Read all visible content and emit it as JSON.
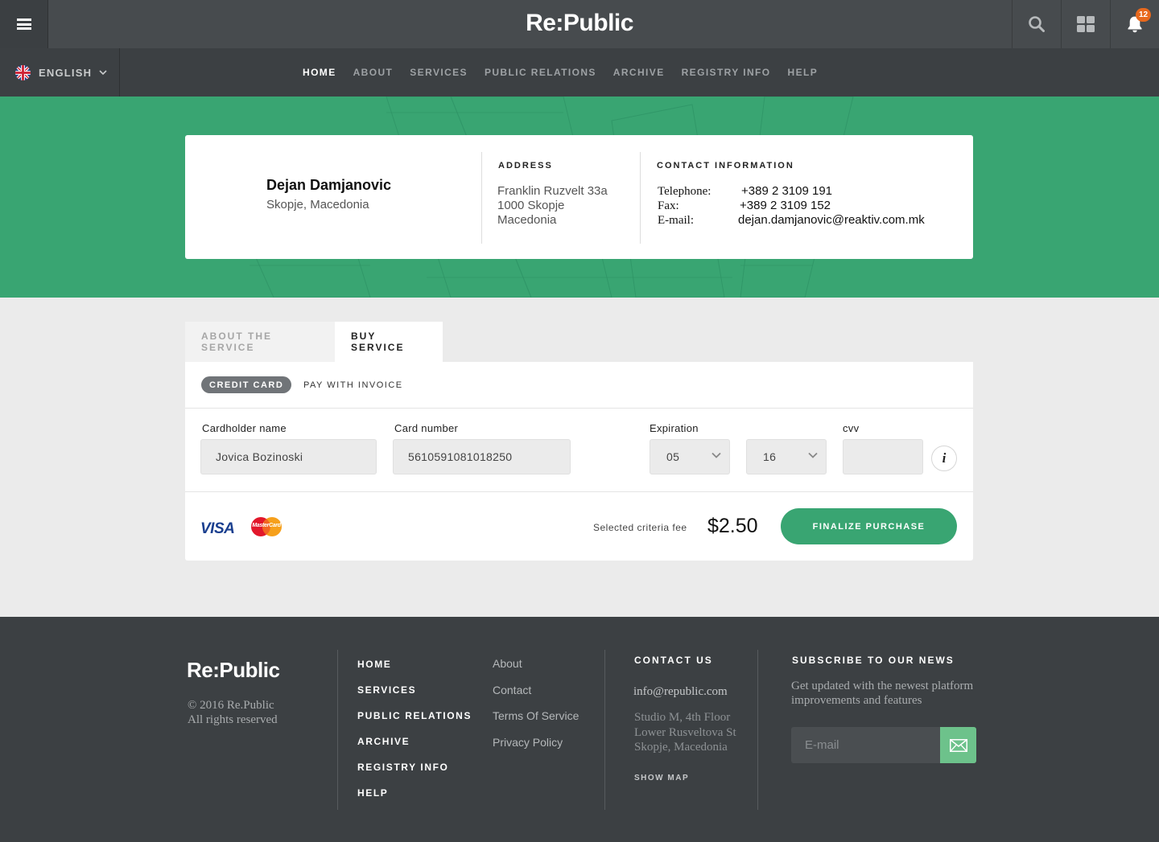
{
  "header": {
    "logo": "Re:Public",
    "notification_count": "12"
  },
  "language": {
    "selected": "ENGLISH"
  },
  "nav": {
    "items": [
      "HOME",
      "ABOUT",
      "SERVICES",
      "PUBLIC RELATIONS",
      "ARCHIVE",
      "REGISTRY INFO",
      "HELP"
    ],
    "active": "HOME"
  },
  "profile": {
    "name": "Dejan Damjanovic",
    "location": "Skopje, Macedonia",
    "address_heading": "ADDRESS",
    "address_lines": [
      "Franklin Ruzvelt 33a",
      "1000 Skopje",
      "Macedonia"
    ],
    "contact_heading": "CONTACT INFORMATION",
    "contact": [
      {
        "label": "Telephone:",
        "value": "+389 2 3109 191"
      },
      {
        "label": "Fax:",
        "value": "+389 2 3109 152"
      },
      {
        "label": "E-mail:",
        "value": "dejan.damjanovic@reaktiv.com.mk"
      }
    ]
  },
  "tabs": [
    {
      "label": "ABOUT THE SERVICE",
      "active": false
    },
    {
      "label": "BUY SERVICE",
      "active": true
    }
  ],
  "payment": {
    "methods": {
      "credit_card": "CREDIT CARD",
      "invoice": "PAY WITH INVOICE"
    },
    "fields": {
      "cardholder_label": "Cardholder name",
      "cardholder_value": "Jovica Bozinoski",
      "card_number_label": "Card number",
      "card_number_value": "5610591081018250",
      "expiration_label": "Expiration",
      "exp_month": "05",
      "exp_year": "16",
      "cvv_label": "cvv",
      "cvv_value": ""
    },
    "info_icon": "i",
    "brands": {
      "visa": "VISA",
      "mastercard": "MasterCard"
    },
    "fee_label": "Selected criteria fee",
    "fee_value": "$2.50",
    "finalize_label": "FINALIZE PURCHASE"
  },
  "footer": {
    "logo": "Re:Public",
    "copyright": [
      "© 2016 Re.Public",
      "All rights reserved"
    ],
    "nav": [
      "HOME",
      "SERVICES",
      "PUBLIC RELATIONS",
      "ARCHIVE",
      "REGISTRY INFO",
      "HELP"
    ],
    "links": [
      "About",
      "Contact",
      "Terms Of Service",
      "Privacy Policy"
    ],
    "contact_heading": "CONTACT US",
    "contact_email": "info@republic.com",
    "contact_address": [
      "Studio M, 4th Floor",
      "Lower Rusveltova St",
      "Skopje, Macedonia"
    ],
    "show_map": "SHOW MAP",
    "subscribe_heading": "SUBSCRIBE TO OUR NEWS",
    "subscribe_text": "Get updated with the newest platform improvements and features",
    "email_placeholder": "E-mail"
  },
  "colors": {
    "accent": "#39a572",
    "topbar": "#474b4e",
    "navbar": "#3c4043",
    "badge": "#e8681c"
  }
}
